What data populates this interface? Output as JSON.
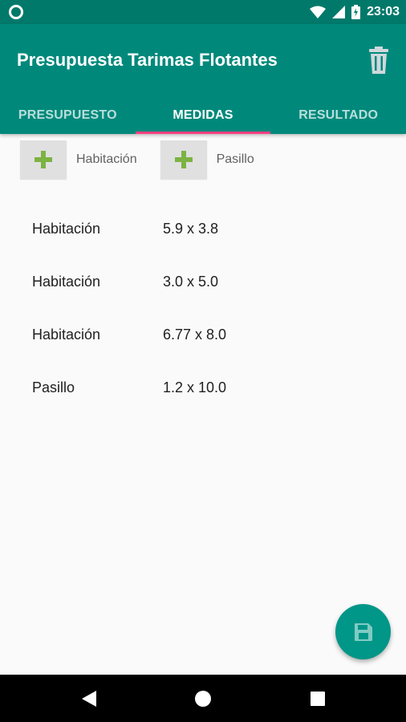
{
  "status_bar": {
    "time": "23:03",
    "icons": [
      "circle-notification-icon",
      "wifi-icon",
      "signal-icon",
      "battery-icon"
    ]
  },
  "appbar": {
    "title": "Presupuesta Tarimas Flotantes",
    "action_icon": "trash-icon",
    "color": "#00897b"
  },
  "tabs": [
    {
      "label": "PRESUPUESTO",
      "active": false
    },
    {
      "label": "MEDIDAS",
      "active": true
    },
    {
      "label": "RESULTADO",
      "active": false
    }
  ],
  "add_buttons": [
    {
      "label": "Habitación",
      "icon": "plus-icon"
    },
    {
      "label": "Pasillo",
      "icon": "plus-icon"
    }
  ],
  "measurements": [
    {
      "name": "Habitación",
      "size": "5.9 x 3.8"
    },
    {
      "name": "Habitación",
      "size": "3.0 x 5.0"
    },
    {
      "name": "Habitación",
      "size": "6.77 x 8.0"
    },
    {
      "name": "Pasillo",
      "size": "1.2 x 10.0"
    }
  ],
  "fab": {
    "icon": "save-icon",
    "color": "#009688"
  },
  "navbar": {
    "icons": [
      "back-icon",
      "home-icon",
      "recents-icon"
    ]
  },
  "colors": {
    "primary": "#00897b",
    "primary_dark": "#00796b",
    "accent": "#ff4081",
    "plus": "#7cb342"
  }
}
